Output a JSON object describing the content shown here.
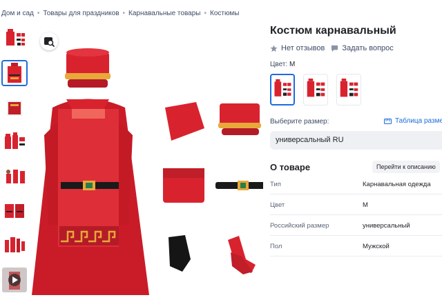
{
  "breadcrumb": [
    "Дом и сад",
    "Товары для праздников",
    "Карнавальные товары",
    "Костюмы"
  ],
  "thumbnails": [
    {
      "kind": "photo",
      "active": false
    },
    {
      "kind": "photo",
      "active": true
    },
    {
      "kind": "photo",
      "active": false
    },
    {
      "kind": "photo",
      "active": false
    },
    {
      "kind": "photo",
      "active": false
    },
    {
      "kind": "photo",
      "active": false
    },
    {
      "kind": "photo",
      "active": false
    },
    {
      "kind": "video",
      "active": false
    }
  ],
  "zoom_icon": "image-search-icon",
  "product": {
    "title": "Костюм карнавальный",
    "reviews": "Нет отзывов",
    "ask": "Задать вопрос",
    "color_label": "Цвет:",
    "color_value": "M",
    "size_label": "Выберите размер:",
    "size_table": "Таблица размеров",
    "size_value": "универсальный RU"
  },
  "about": {
    "title": "О товаре",
    "link": "Перейти к описанию",
    "specs": [
      {
        "key": "Тип",
        "value": "Карнавальная одежда"
      },
      {
        "key": "Цвет",
        "value": "M"
      },
      {
        "key": "Российский размер",
        "value": "универсальный"
      },
      {
        "key": "Пол",
        "value": "Мужской"
      }
    ]
  },
  "colors": {
    "accent": "#1b6cdb",
    "costume_red": "#d8232f",
    "costume_dark": "#a8141f",
    "trim_gold": "#e8a83a"
  }
}
